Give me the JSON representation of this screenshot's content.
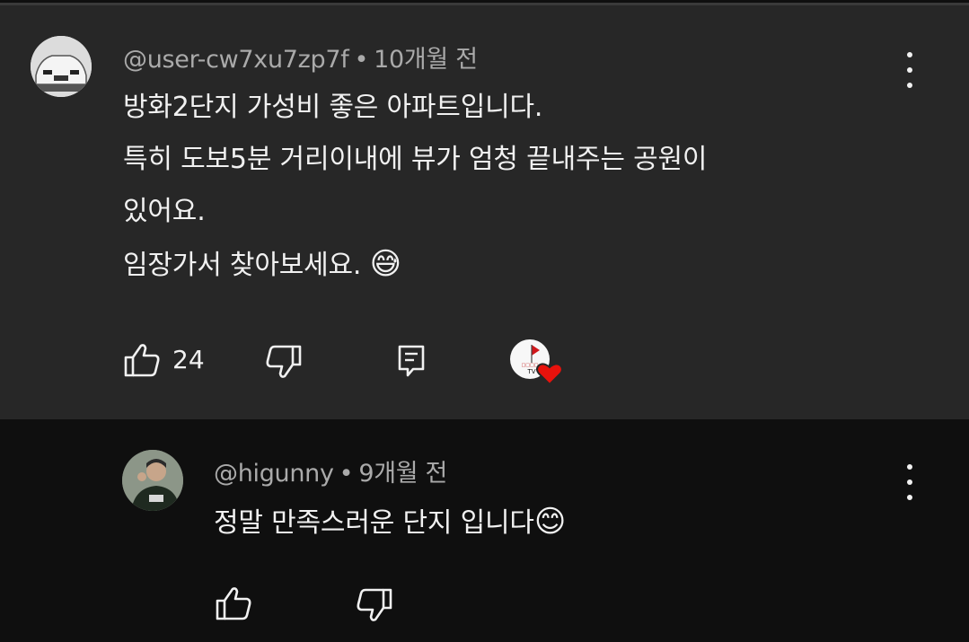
{
  "comments": [
    {
      "author": "@user-cw7xu7zp7f",
      "time": "10개월 전",
      "lines": [
        "방화2단지 가성비 좋은 아파트입니다.",
        "특히 도보5분 거리이내에 뷰가 엄청 끝내주는 공원이",
        "있어요.",
        "임장가서 찾아보세요."
      ],
      "emoji": "😅",
      "likes": "24",
      "creator_heart_caption": "TV"
    },
    {
      "author": "@higunny",
      "time": "9개월 전",
      "lines": [
        "정말 만족스러운 단지 입니다"
      ],
      "emoji": "😊"
    }
  ],
  "separator": "•",
  "icons": {
    "like": "thumbs-up-icon",
    "dislike": "thumbs-down-icon",
    "reply": "reply-icon",
    "menu": "more-vertical-icon",
    "heart": "creator-heart-icon"
  },
  "colors": {
    "main_bg": "#272727",
    "reply_bg": "#0f0f0f",
    "text": "#f1f1f1",
    "meta": "#aaaaaa",
    "heart": "#e8120c"
  }
}
